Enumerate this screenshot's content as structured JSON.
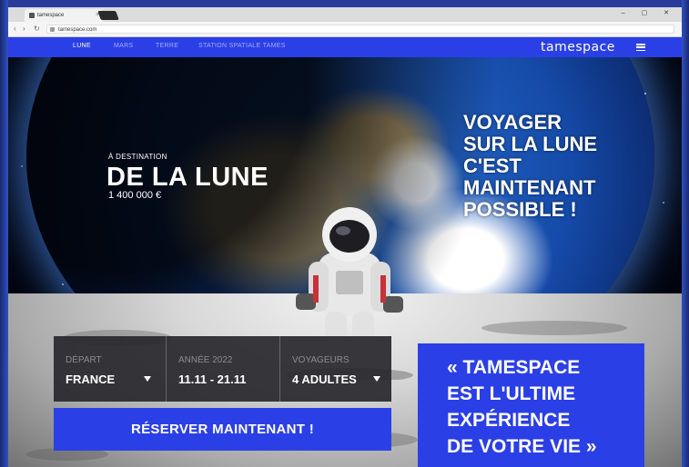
{
  "browser": {
    "tab_title": "tamespace",
    "tab_close": "×",
    "window_controls": "– ▢ ✕",
    "url": "tamespace.com",
    "back_icon": "arrow-left-icon",
    "forward_icon": "arrow-right-icon",
    "reload_icon": "reload-icon"
  },
  "nav": {
    "items": [
      {
        "label": "LUNE",
        "active": true
      },
      {
        "label": "MARS",
        "active": false
      },
      {
        "label": "TERRE",
        "active": false
      },
      {
        "label": "STATION SPATIALE TAMES",
        "active": false
      }
    ],
    "logo": "tamespace",
    "menu_icon": "hamburger-menu-icon"
  },
  "hero": {
    "destination_prefix": "À DESTINATION",
    "destination_name": "DE LA LUNE",
    "price": "1 400 000 €",
    "headline": [
      "VOYAGER",
      "SUR LA LUNE",
      "C'EST",
      "MAINTENANT",
      "POSSIBLE !"
    ]
  },
  "booking": {
    "fields": [
      {
        "label": "DÉPART",
        "value": "FRANCE",
        "dropdown": true
      },
      {
        "label": "ANNÉE 2022",
        "value": "11.11 - 21.11",
        "dropdown": false
      },
      {
        "label": "VOYAGEURS",
        "value": "4 ADULTES",
        "dropdown": true
      }
    ],
    "cta": "RÉSERVER MAINTENANT !"
  },
  "quote": [
    "« TAMESPACE",
    "EST L'ULTIME",
    "EXPÉRIENCE",
    "DE VOTRE VIE »"
  ],
  "colors": {
    "brand": "#2b3fe6",
    "booking_bg": "#28282c"
  }
}
